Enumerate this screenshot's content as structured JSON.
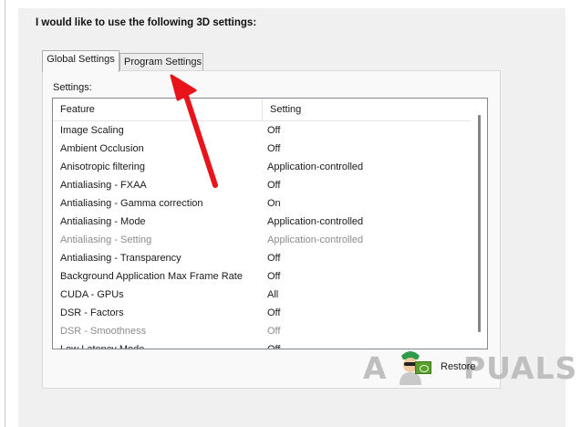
{
  "heading": "I would like to use the following 3D settings:",
  "tabs": [
    {
      "label": "Global Settings",
      "active": true
    },
    {
      "label": "Program Settings",
      "active": false
    }
  ],
  "settings_label": "Settings:",
  "columns": {
    "feature": "Feature",
    "setting": "Setting"
  },
  "rows": [
    {
      "feature": "Image Scaling",
      "setting": "Off",
      "disabled": false
    },
    {
      "feature": "Ambient Occlusion",
      "setting": "Off",
      "disabled": false
    },
    {
      "feature": "Anisotropic filtering",
      "setting": "Application-controlled",
      "disabled": false
    },
    {
      "feature": "Antialiasing - FXAA",
      "setting": "Off",
      "disabled": false
    },
    {
      "feature": "Antialiasing - Gamma correction",
      "setting": "On",
      "disabled": false
    },
    {
      "feature": "Antialiasing - Mode",
      "setting": "Application-controlled",
      "disabled": false
    },
    {
      "feature": "Antialiasing - Setting",
      "setting": "Application-controlled",
      "disabled": true
    },
    {
      "feature": "Antialiasing - Transparency",
      "setting": "Off",
      "disabled": false
    },
    {
      "feature": "Background Application Max Frame Rate",
      "setting": "Off",
      "disabled": false
    },
    {
      "feature": "CUDA - GPUs",
      "setting": "All",
      "disabled": false
    },
    {
      "feature": "DSR - Factors",
      "setting": "Off",
      "disabled": false
    },
    {
      "feature": "DSR - Smoothness",
      "setting": "Off",
      "disabled": true
    },
    {
      "feature": "Low Latency Mode",
      "setting": "Off",
      "disabled": false
    }
  ],
  "restore": {
    "label": "Restore",
    "icon": "nvidia-icon"
  },
  "watermark": {
    "text_left": "A",
    "text_right": "PUALS"
  },
  "colors": {
    "arrow": "#e8141b",
    "nvidia_green": "#5a9e2e",
    "watermark": "#bfbfbf"
  }
}
